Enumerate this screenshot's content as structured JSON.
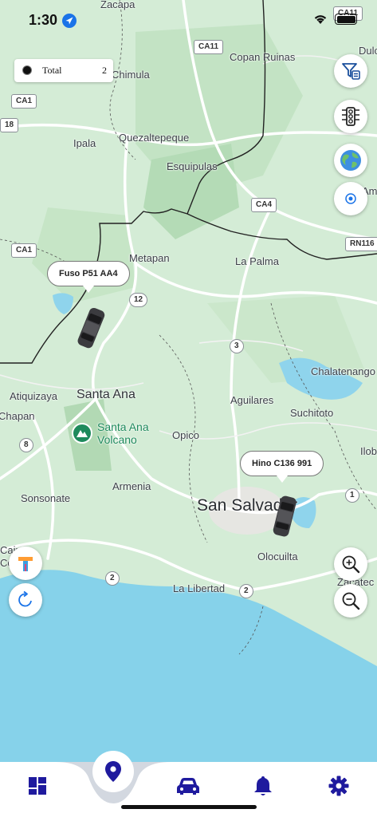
{
  "status_bar": {
    "time": "1:30"
  },
  "legend": {
    "label": "Total",
    "count": "2"
  },
  "vehicles": [
    {
      "name": "Fuso P51 AA4"
    },
    {
      "name": "Hino C136 991"
    }
  ],
  "map": {
    "places": [
      "Zacapa",
      "Copan Ruinas",
      "Dulce",
      "Chimula",
      "Quezaltepeque",
      "Ipala",
      "Esquipulas",
      "Ame",
      "Metapan",
      "La Palma",
      "Chalatenango",
      "Atiquizaya",
      "Santa Ana",
      "Aguilares",
      "Suchitoto",
      "Chapan",
      "Opico",
      "Ilob",
      "Armenia",
      "Sonsonate",
      "San Salvador",
      "Olocuilta",
      "Zacatec",
      "La Libertad",
      "Cajut",
      "Comas"
    ],
    "park": "Santa Ana Volcano",
    "route_shields": [
      "CA11",
      "CA11",
      "18",
      "CA1",
      "CA4",
      "RN116",
      "CA1",
      "12",
      "3",
      "8",
      "1",
      "2",
      "2"
    ]
  },
  "colors": {
    "land": "#d4ecd6",
    "forest": "#b7dcb8",
    "water": "#86d2ea",
    "road": "#ffffff",
    "border": "#222222",
    "accent": "#1f1a9e"
  },
  "icons": {
    "filter": "filter-icon",
    "traffic": "traffic-light-icon",
    "globe": "globe-icon",
    "locate": "locate-icon",
    "zoom_in": "zoom-in-icon",
    "zoom_out": "zoom-out-icon",
    "refresh": "refresh-icon",
    "app": "t-logo-icon",
    "nav_dashboard": "dashboard-icon",
    "nav_map": "map-pin-icon",
    "nav_vehicles": "car-icon",
    "nav_alerts": "bell-icon",
    "nav_settings": "gear-icon"
  }
}
